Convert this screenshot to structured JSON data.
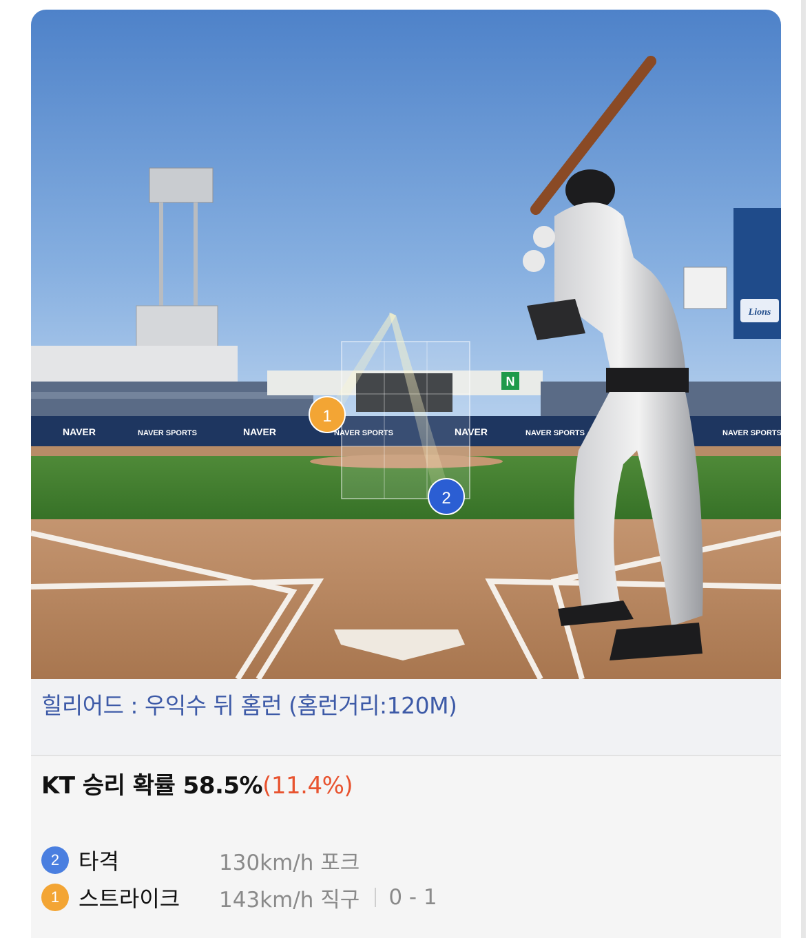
{
  "scene": {
    "ad_text": [
      "NAVER",
      "NAVER SPORTS"
    ],
    "sign_text": "N",
    "team_logo": "Lions",
    "markers": [
      {
        "number": "1",
        "color": "#f3a534"
      },
      {
        "number": "2",
        "color": "#2b5ed3"
      }
    ]
  },
  "caption": "힐리어드 : 우익수 뒤 홈런 (홈런거리:120M)",
  "win_prob": {
    "label": "KT 승리 확률 58.5%",
    "delta": "(11.4%)"
  },
  "pitches": [
    {
      "number": "2",
      "result": "타격",
      "detail": "130km/h 포크",
      "count": "",
      "badge_color": "#4a7fe0"
    },
    {
      "number": "1",
      "result": "스트라이크",
      "detail": "143km/h 직구",
      "count": "0 - 1",
      "badge_color": "#f3a534"
    }
  ],
  "colors": {
    "caption": "#3d5aa7",
    "delta": "#e8532f",
    "sky_top": "#4e82c9",
    "grass": "#3f7a2c",
    "dirt": "#b58660"
  }
}
